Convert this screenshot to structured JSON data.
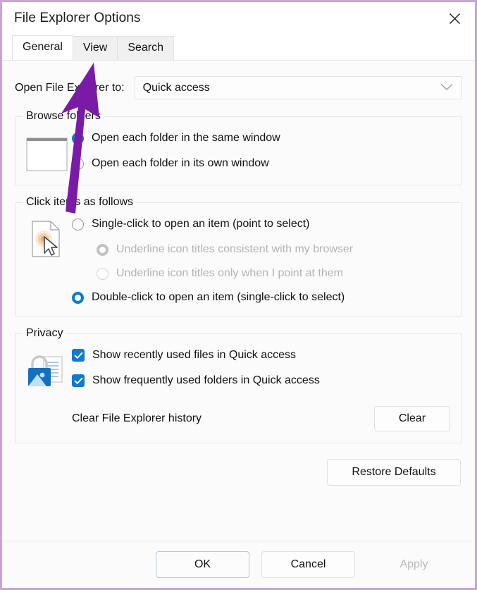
{
  "window": {
    "title": "File Explorer Options",
    "close_icon": "close-icon",
    "border_color": "#c9a3dd"
  },
  "tabs": [
    {
      "label": "General",
      "active": true
    },
    {
      "label": "View",
      "active": false
    },
    {
      "label": "Search",
      "active": false
    }
  ],
  "open_to": {
    "label": "Open File Explorer to:",
    "value": "Quick access",
    "arrow_icon": "chevron-down-icon"
  },
  "browse_folders": {
    "title": "Browse folders",
    "icon": "window-outline-icon",
    "options": [
      {
        "label": "Open each folder in the same window",
        "checked": true,
        "disabled": false
      },
      {
        "label": "Open each folder in its own window",
        "checked": false,
        "disabled": false
      }
    ]
  },
  "click_items": {
    "title": "Click items as follows",
    "icon": "document-click-icon",
    "options": [
      {
        "label": "Single-click to open an item (point to select)",
        "checked": false,
        "disabled": false,
        "indent": false
      },
      {
        "label": "Underline icon titles consistent with my browser",
        "checked": true,
        "disabled": true,
        "indent": true
      },
      {
        "label": "Underline icon titles only when I point at them",
        "checked": false,
        "disabled": true,
        "indent": true
      },
      {
        "label": "Double-click to open an item (single-click to select)",
        "checked": true,
        "disabled": false,
        "indent": false
      }
    ]
  },
  "privacy": {
    "title": "Privacy",
    "icon": "lock-document-icon",
    "checkboxes": [
      {
        "label": "Show recently used files in Quick access",
        "checked": true
      },
      {
        "label": "Show frequently used folders in Quick access",
        "checked": true
      }
    ],
    "clear_label": "Clear File Explorer history",
    "clear_button": "Clear"
  },
  "restore_defaults_button": "Restore Defaults",
  "footer": {
    "ok": "OK",
    "cancel": "Cancel",
    "apply": "Apply",
    "apply_disabled": true
  },
  "annotation": {
    "type": "arrow",
    "color": "#7a1ba8",
    "points_to": "View tab"
  },
  "colors": {
    "accent": "#0d7ad4",
    "checkbox": "#0f79d3",
    "annotation": "#7a1ba8",
    "focus_border": "#a8cbe4"
  }
}
